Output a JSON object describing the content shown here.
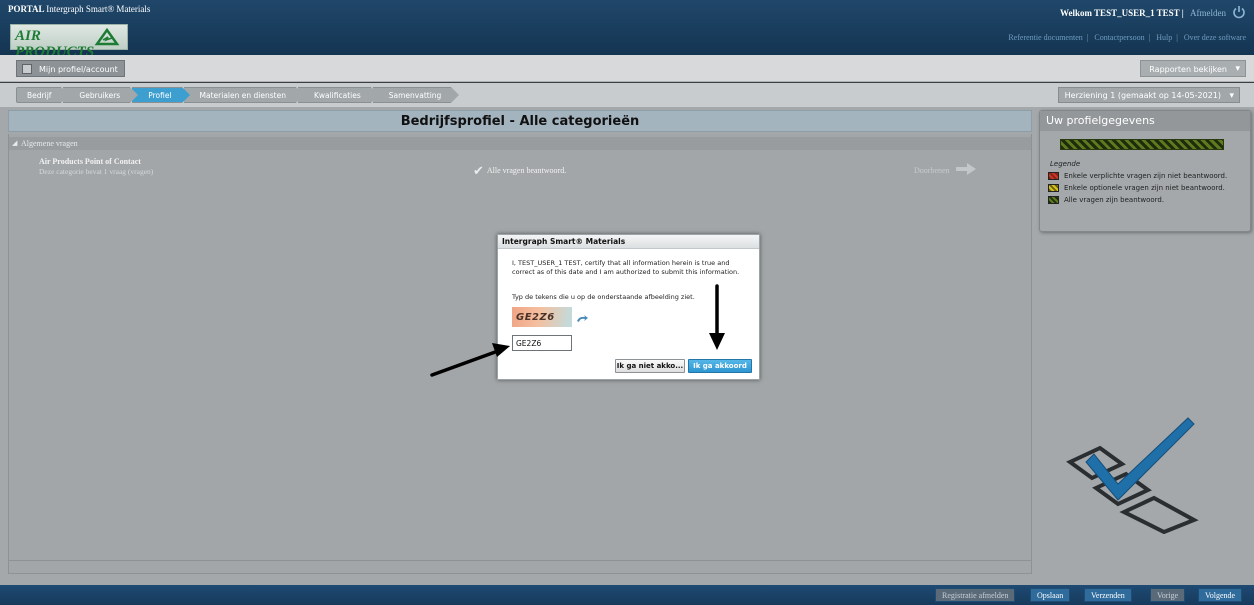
{
  "header": {
    "portal_label": "PORTAL",
    "app_name": "Intergraph Smart® Materials",
    "logo_text": "AIR\nPRODUCTS",
    "welcome": "Welkom TEST_USER_1 TEST  |",
    "logout": "Afmelden",
    "links": [
      "Referentie documenten",
      "Contactpersoon",
      "Hulp",
      "Over deze software"
    ]
  },
  "toolbar": {
    "profile_button": "Mijn profiel/account",
    "reports_button": "Rapporten bekijken"
  },
  "steps": [
    {
      "label": "Bedrijf",
      "active": false
    },
    {
      "label": "Gebruikers",
      "active": false
    },
    {
      "label": "Profiel",
      "active": true
    },
    {
      "label": "Materialen en diensten",
      "active": false
    },
    {
      "label": "Kwalificaties",
      "active": false
    },
    {
      "label": "Samenvatting",
      "active": false
    }
  ],
  "revision": "Herziening 1 (gemaakt op 14-05-2021)",
  "main": {
    "title": "Bedrijfsprofiel - Alle categorieën",
    "section": "Algemene vragen",
    "category_name": "Air Products Point of Contact",
    "category_sub": "Deze categorie bevat 1 vraag (vragen)",
    "status": "Alle vragen beantwoord.",
    "continue": "Doorbenen"
  },
  "profile_panel": {
    "title": "Uw profielgegevens",
    "progress": 1.0,
    "legend_title": "Legende",
    "legend": [
      {
        "label": "Enkele verplichte vragen zijn niet beantwoord.",
        "color": "#c0392b"
      },
      {
        "label": "Enkele optionele vragen zijn niet beantwoord.",
        "color": "#d4c020"
      },
      {
        "label": "Alle vragen zijn beantwoord.",
        "color": "#5e7a1f"
      }
    ]
  },
  "bottom_buttons": [
    "Registratie afmelden",
    "Opslaan",
    "Verzenden",
    "Vorige",
    "Volgende"
  ],
  "modal": {
    "title": "Intergraph Smart® Materials",
    "body": "I, TEST_USER_1 TEST, certify that all information herein is true and correct as of this date and I am authorized to submit this information.",
    "instruction": "Typ de tekens die u op de onderstaande afbeelding ziet.",
    "captcha_text": "GE2Z6",
    "input_value": "GE2Z6",
    "disagree_button": "Ik ga niet akko...",
    "agree_button": "Ik ga akkoord"
  }
}
